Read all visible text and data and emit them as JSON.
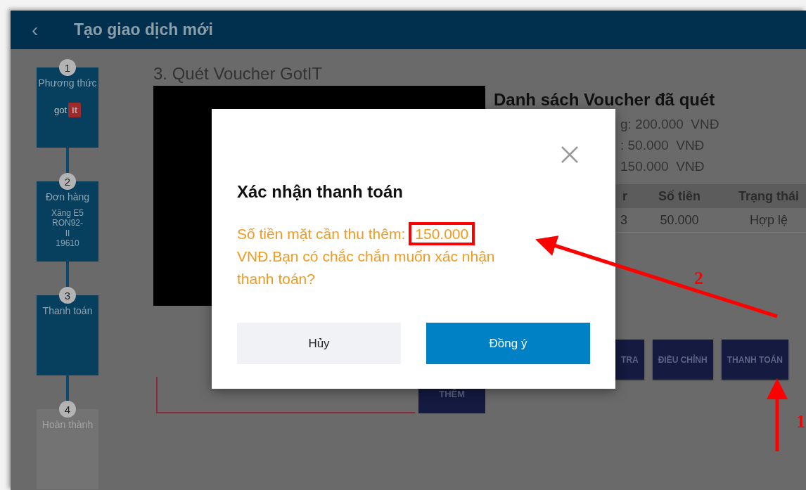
{
  "header": {
    "back": "‹",
    "title": "Tạo giao dịch mới"
  },
  "steps": [
    {
      "number": "1",
      "title": "Phương thức",
      "logo": {
        "word": "got",
        "badge": "it"
      },
      "disabled": false
    },
    {
      "number": "2",
      "title": "Đơn hàng",
      "detail": "Xăng E5 RON92-\nII\n19610",
      "disabled": false
    },
    {
      "number": "3",
      "title": "Thanh toán",
      "disabled": false
    },
    {
      "number": "4",
      "title": "Hoàn thành",
      "disabled": true
    }
  ],
  "main": {
    "title": "3. Quét Voucher GotIT",
    "add_button": "THÊM"
  },
  "voucher_list": {
    "title": "Danh sách Voucher đã quét",
    "summary": [
      "g: 200.000  VNĐ",
      ": 50.000  VNĐ",
      "150.000  VNĐ"
    ],
    "columns": [
      "r",
      "Số tiền",
      "Trạng thái"
    ],
    "rows": [
      [
        "3",
        "50.000",
        "Hợp lệ"
      ]
    ],
    "actions": [
      "TRA",
      "ĐIỀU CHỈNH",
      "THANH TOÁN"
    ]
  },
  "dialog": {
    "title": "Xác nhận thanh toán",
    "message_lead": "Số tiền mặt cần thu thêm:",
    "amount": "150.000",
    "amount_highlighted": true,
    "message_tail": "VNĐ.Bạn có chắc chắn muốn xác nhận thanh toán?",
    "buttons": [
      {
        "label": "Hủy",
        "kind": "secondary"
      },
      {
        "label": "Đồng ý",
        "kind": "primary"
      }
    ]
  },
  "annotations": [
    {
      "label": "2"
    },
    {
      "label": "1"
    }
  ]
}
